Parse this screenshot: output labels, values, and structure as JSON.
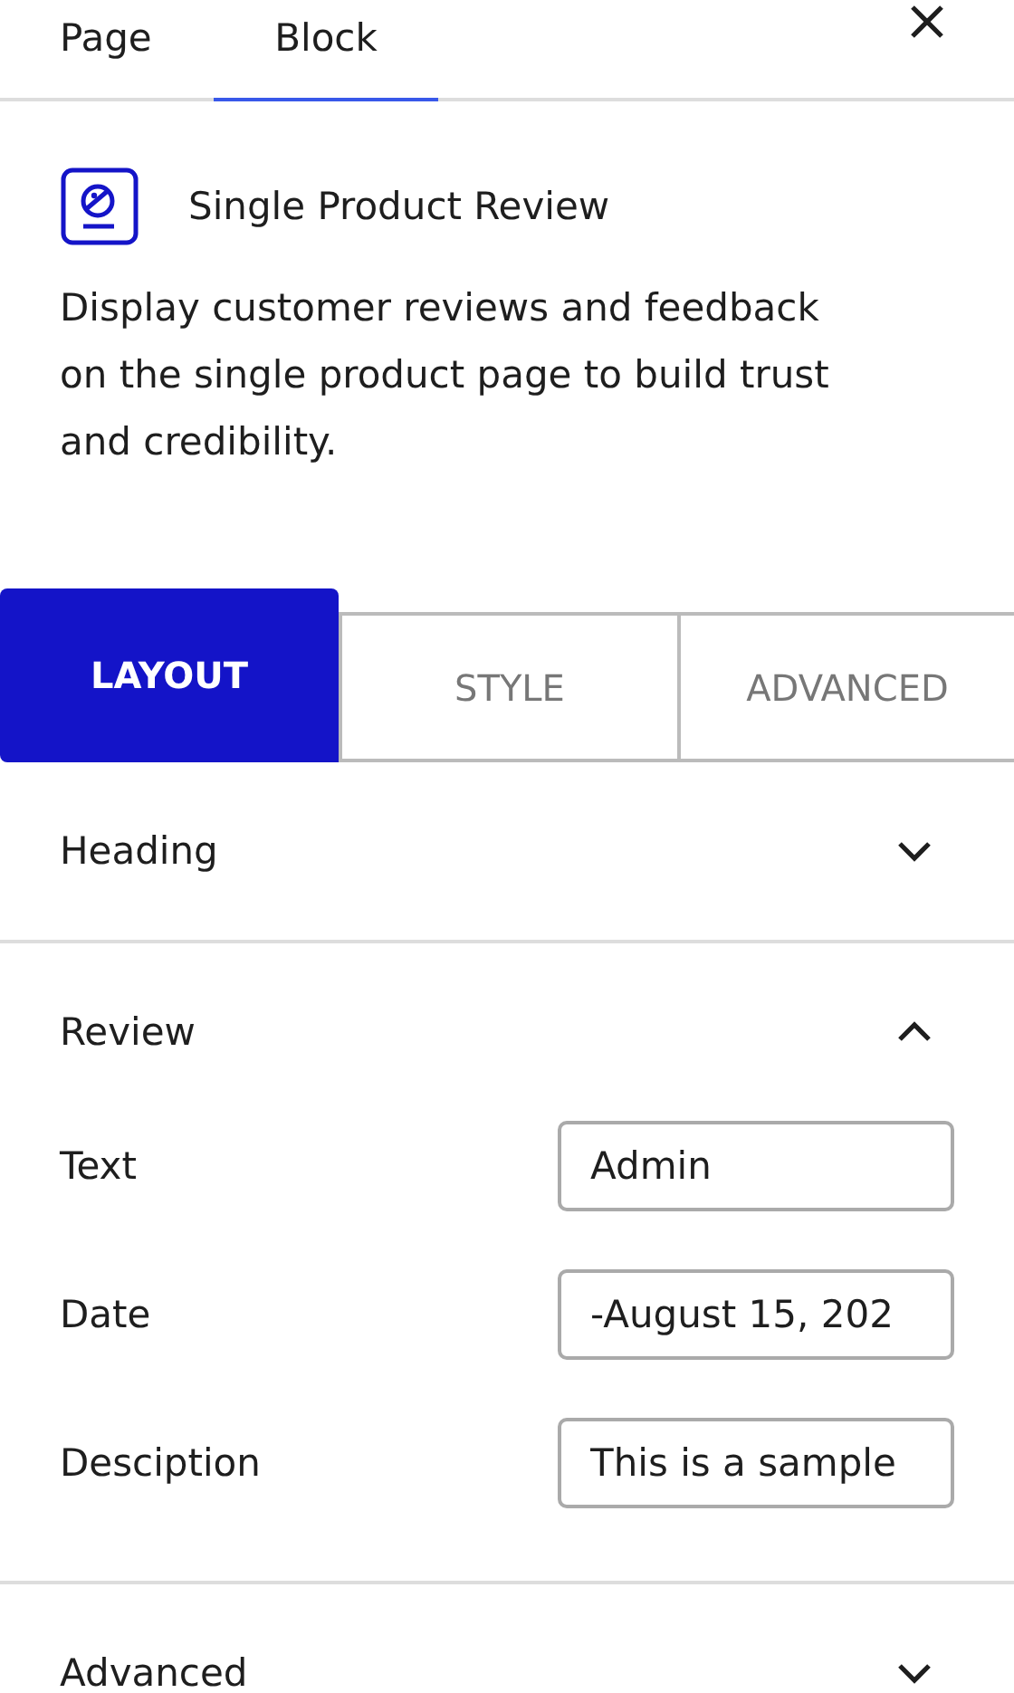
{
  "top_tabs": [
    {
      "label": "Page",
      "selected": false
    },
    {
      "label": "Block",
      "selected": true
    }
  ],
  "block": {
    "title": "Single Product Review",
    "description": "Display customer reviews and feedback on the single product page to build trust and credibility."
  },
  "inner_tabs": [
    {
      "label": "LAYOUT",
      "selected": true
    },
    {
      "label": "STYLE",
      "selected": false
    },
    {
      "label": "ADVANCED",
      "selected": false
    }
  ],
  "panels": [
    {
      "title": "Heading",
      "expanded": false
    },
    {
      "title": "Review",
      "expanded": true,
      "fields": [
        {
          "label": "Text",
          "value": "Admin"
        },
        {
          "label": "Date",
          "value": "-August 15, 202"
        },
        {
          "label": "Desciption",
          "value": "This is a sample"
        }
      ]
    },
    {
      "title": "Advanced",
      "expanded": false
    }
  ]
}
